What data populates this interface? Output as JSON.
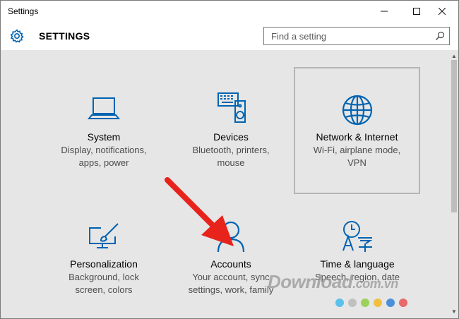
{
  "window": {
    "title": "Settings"
  },
  "header": {
    "title": "SETTINGS",
    "search_placeholder": "Find a setting"
  },
  "tiles": [
    {
      "name": "System",
      "desc1": "Display, notifications,",
      "desc2": "apps, power"
    },
    {
      "name": "Devices",
      "desc1": "Bluetooth, printers,",
      "desc2": "mouse"
    },
    {
      "name": "Network & Internet",
      "desc1": "Wi-Fi, airplane mode,",
      "desc2": "VPN"
    },
    {
      "name": "Personalization",
      "desc1": "Background, lock",
      "desc2": "screen, colors"
    },
    {
      "name": "Accounts",
      "desc1": "Your account, sync",
      "desc2": "settings, work, family"
    },
    {
      "name": "Time & language",
      "desc1": "Speech, region, date",
      "desc2": ""
    }
  ],
  "watermark": {
    "text": "Download",
    "suffix": ".com.vn"
  },
  "colors": {
    "accent": "#0063b1",
    "arrow": "#e8231c"
  },
  "dots": [
    "#5bc0eb",
    "#c0c0c0",
    "#9bd15a",
    "#f0c040",
    "#4a90d9",
    "#e86a6a"
  ]
}
